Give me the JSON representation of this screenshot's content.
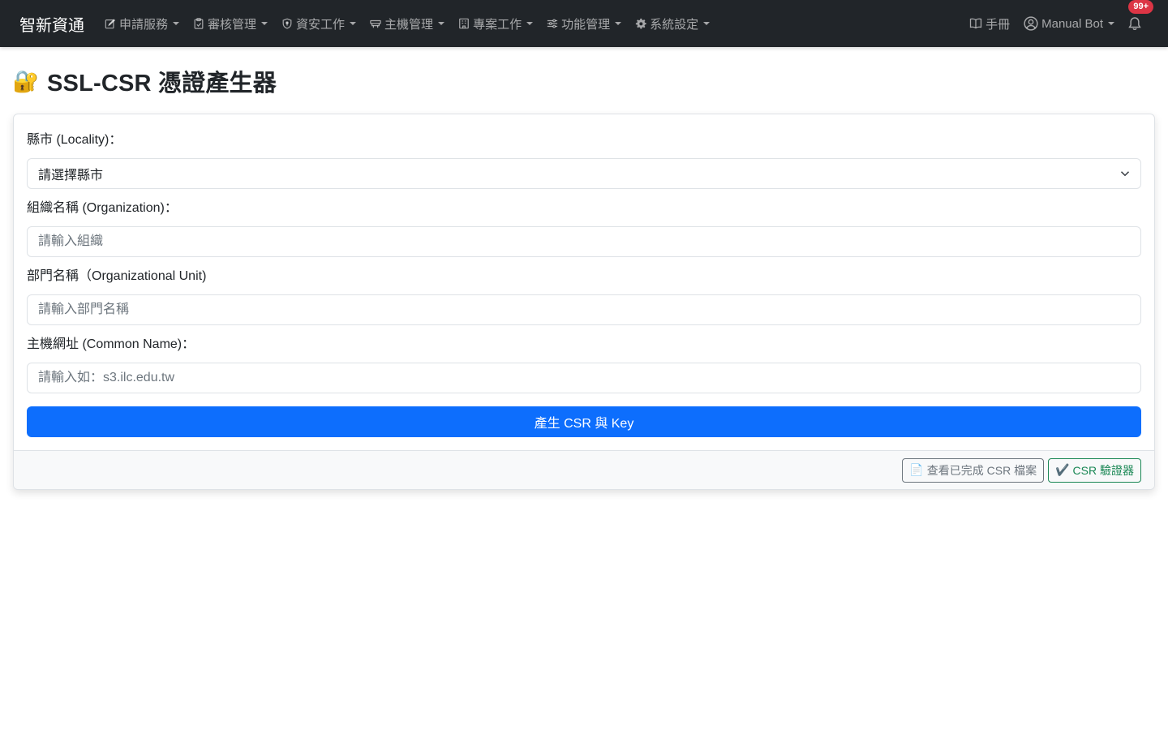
{
  "navbar": {
    "brand": "智新資通",
    "menus": [
      {
        "label": "申請服務",
        "icon": "pencil-square-icon"
      },
      {
        "label": "審核管理",
        "icon": "clipboard-check-icon"
      },
      {
        "label": "資安工作",
        "icon": "shield-icon"
      },
      {
        "label": "主機管理",
        "icon": "server-icon"
      },
      {
        "label": "專案工作",
        "icon": "building-icon"
      },
      {
        "label": "功能管理",
        "icon": "sliders-icon"
      },
      {
        "label": "系統設定",
        "icon": "gear-icon"
      }
    ],
    "manual_label": "手冊",
    "user_label": "Manual Bot",
    "notification_badge": "99+"
  },
  "page": {
    "title_icon": "🔐",
    "title": "SSL-CSR 憑證產生器"
  },
  "form": {
    "locality": {
      "label": "縣市 (Locality)：",
      "selected": "請選擇縣市"
    },
    "organization": {
      "label": "組織名稱 (Organization)：",
      "placeholder": "請輸入組織"
    },
    "unit": {
      "label": "部門名稱（Organizational Unit)",
      "placeholder": "請輸入部門名稱"
    },
    "common_name": {
      "label": "主機網址 (Common Name)：",
      "placeholder": "請輸入如：s3.ilc.edu.tw"
    },
    "submit_label": "產生 CSR 與 Key"
  },
  "footer": {
    "view_files_icon": "📄",
    "view_files_label": "查看已完成 CSR 檔案",
    "validator_icon": "✔️",
    "validator_label": "CSR 驗證器"
  },
  "colors": {
    "navbar_bg": "#212529",
    "primary": "#0d6efd",
    "success": "#198754",
    "secondary": "#6c757d",
    "danger": "#dc3545"
  }
}
